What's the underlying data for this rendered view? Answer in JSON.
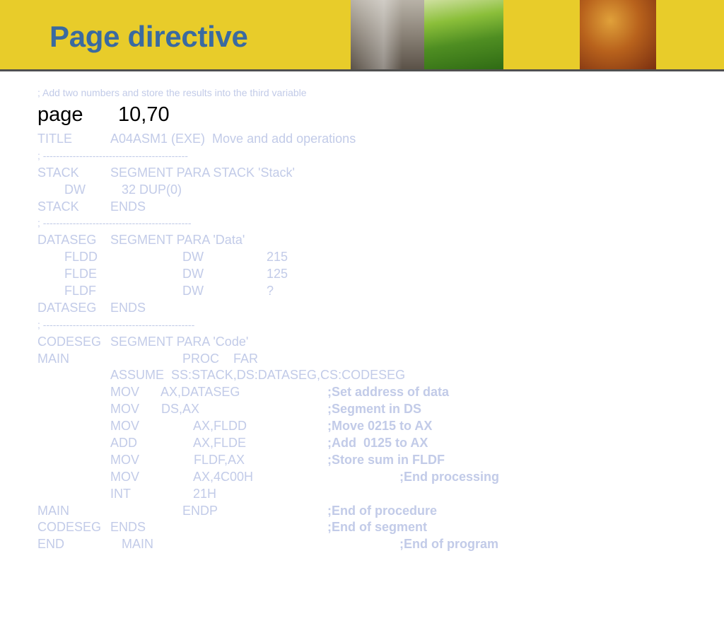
{
  "slide": {
    "title": "Page directive",
    "colors": {
      "header_background": "#e8cc2a",
      "title_color": "#3a6aa0",
      "code_color": "#c2cbe8",
      "directive_color": "#000000"
    }
  },
  "code": {
    "comment_line": "; Add two numbers and store the results into the third variable",
    "page_keyword": "page",
    "page_value": "10,70",
    "title_keyword": "TITLE",
    "title_text": "A04ASM1 (EXE)  Move and add operations",
    "separator_1": "; --------------------------------------------",
    "stack_name": "STACK",
    "stack_segment": "SEGMENT PARA STACK 'Stack'",
    "stack_dw": "DW",
    "stack_dup": "32 DUP(0)",
    "stack_end_name": "STACK",
    "stack_ends": "ENDS",
    "separator_2": "; ---------------------------------------------",
    "dataseg_name": "DATASEG",
    "dataseg_segment": "SEGMENT PARA 'Data'",
    "fldd_name": "FLDD",
    "fldd_type": "DW",
    "fldd_value": "215",
    "flde_name": "FLDE",
    "flde_type": "DW",
    "flde_value": "125",
    "fldf_name": "FLDF",
    "fldf_type": "DW",
    "fldf_value": "?",
    "dataseg_end_name": "DATASEG",
    "dataseg_ends": "ENDS",
    "separator_3": "; ----------------------------------------------",
    "codeseg_name": "CODESEG",
    "codeseg_segment": "SEGMENT PARA 'Code'",
    "main_name": "MAIN",
    "main_proc": "PROC    FAR",
    "assume": "ASSUME  SS:STACK,DS:DATASEG,CS:CODESEG",
    "mov1_op": "MOV",
    "mov1_args": "AX,DATASEG",
    "mov1_comment": ";Set address of data",
    "mov2_op": "MOV",
    "mov2_args": "DS,AX",
    "mov2_comment": ";Segment in DS",
    "mov3_op": "MOV",
    "mov3_args": "AX,FLDD",
    "mov3_comment": ";Move 0215 to AX",
    "add_op": "ADD",
    "add_args": "AX,FLDE",
    "add_comment": ";Add  0125 to AX",
    "mov4_op": "MOV",
    "mov4_args": "FLDF,AX",
    "mov4_comment": ";Store sum in FLDF",
    "mov5_op": "MOV",
    "mov5_args": "AX,4C00H",
    "mov5_comment": ";End processing",
    "int_op": "INT",
    "int_args": "21H",
    "main_end_name": "MAIN",
    "main_endp": "ENDP",
    "main_end_comment": ";End of procedure",
    "codeseg_end_name": "CODESEG",
    "codeseg_ends": "ENDS",
    "codeseg_end_comment": ";End of segment",
    "end_keyword": "END",
    "end_label": "MAIN",
    "end_comment": ";End of program"
  }
}
